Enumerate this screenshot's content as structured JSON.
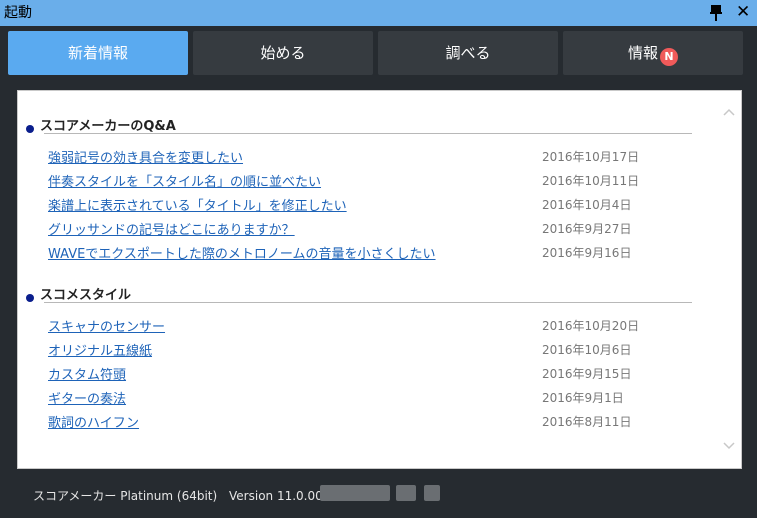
{
  "window": {
    "title": "起動"
  },
  "tabs": [
    {
      "label": "新着情報",
      "active": true
    },
    {
      "label": "始める",
      "active": false
    },
    {
      "label": "調べる",
      "active": false
    },
    {
      "label": "情報",
      "active": false,
      "badge": "N"
    }
  ],
  "sections": [
    {
      "heading": "スコアメーカーのQ&A",
      "items": [
        {
          "title": "強弱記号の効き具合を変更したい",
          "date": "2016年10月17日"
        },
        {
          "title": "伴奏スタイルを「スタイル名」の順に並べたい",
          "date": "2016年10月11日"
        },
        {
          "title": "楽譜上に表示されている「タイトル」を修正したい",
          "date": "2016年10月4日"
        },
        {
          "title": "グリッサンドの記号はどこにありますか？",
          "date": "2016年9月27日"
        },
        {
          "title": "WAVEでエクスポートした際のメトロノームの音量を小さくしたい",
          "date": "2016年9月16日"
        }
      ]
    },
    {
      "heading": "スコメスタイル",
      "items": [
        {
          "title": "スキャナのセンサー",
          "date": "2016年10月20日"
        },
        {
          "title": "オリジナル五線紙",
          "date": "2016年10月6日"
        },
        {
          "title": "カスタム符頭",
          "date": "2016年9月15日"
        },
        {
          "title": "ギターの奏法",
          "date": "2016年9月1日"
        },
        {
          "title": "歌詞のハイフン",
          "date": "2016年8月11日"
        }
      ]
    }
  ],
  "status": {
    "product": "スコアメーカー Platinum (64bit)",
    "version": "Version 11.0.009"
  },
  "colors": {
    "titlebar": "#6aaeea",
    "tab_active": "#5aaaf0",
    "tab_inactive": "#363b40",
    "background": "#262b30",
    "link": "#1e63b8",
    "badge": "#f05a5a"
  }
}
